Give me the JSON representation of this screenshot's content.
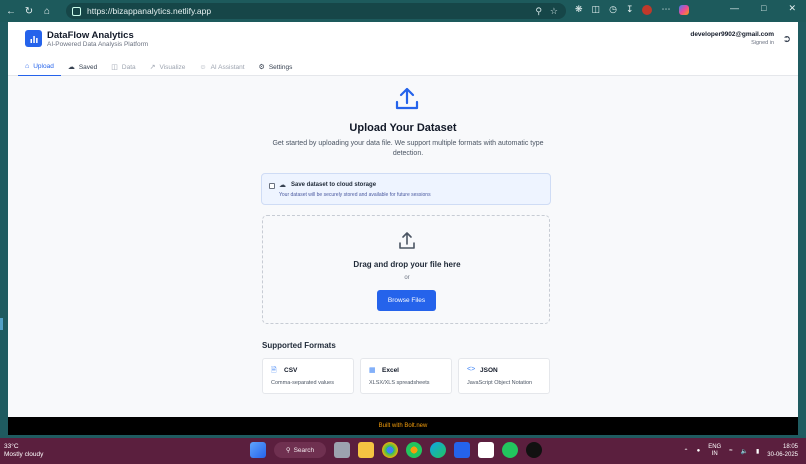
{
  "browser": {
    "url": "https://bizappanalytics.netlify.app"
  },
  "header": {
    "title": "DataFlow Analytics",
    "subtitle": "AI-Powered Data Analysis Platform",
    "user_email": "developer9902@gmail.com",
    "user_status": "Signed in"
  },
  "tabs": [
    {
      "label": "Upload",
      "icon": "home-icon",
      "active": true
    },
    {
      "label": "Saved",
      "icon": "cloud-icon"
    },
    {
      "label": "Data",
      "icon": "database-icon"
    },
    {
      "label": "Visualize",
      "icon": "trend-icon"
    },
    {
      "label": "AI Assistant",
      "icon": "bot-icon"
    },
    {
      "label": "Settings",
      "icon": "gear-icon"
    }
  ],
  "upload": {
    "title": "Upload Your Dataset",
    "description": "Get started by uploading your data file. We support multiple formats with automatic type detection.",
    "cloud_label": "Save dataset to cloud storage",
    "cloud_sub": "Your dataset will be securely stored and available for future sessions",
    "drop_title": "Drag and drop your file here",
    "drop_or": "or",
    "browse_label": "Browse Files",
    "formats_title": "Supported Formats",
    "formats": [
      {
        "name": "CSV",
        "desc": "Comma-separated values"
      },
      {
        "name": "Excel",
        "desc": "XLSX/XLS spreadsheets"
      },
      {
        "name": "JSON",
        "desc": "JavaScript Object Notation"
      }
    ]
  },
  "footer": {
    "text": "Built with Bolt.new"
  },
  "taskbar": {
    "temp": "33°C",
    "weather": "Mostly cloudy",
    "search_label": "Search",
    "lang_top": "ENG",
    "lang_bottom": "IN",
    "time": "18:05",
    "date": "30-06-2025"
  },
  "colors": {
    "accent": "#2563eb",
    "footer_text": "#f59e0b",
    "taskbar": "#5b1f3e"
  }
}
